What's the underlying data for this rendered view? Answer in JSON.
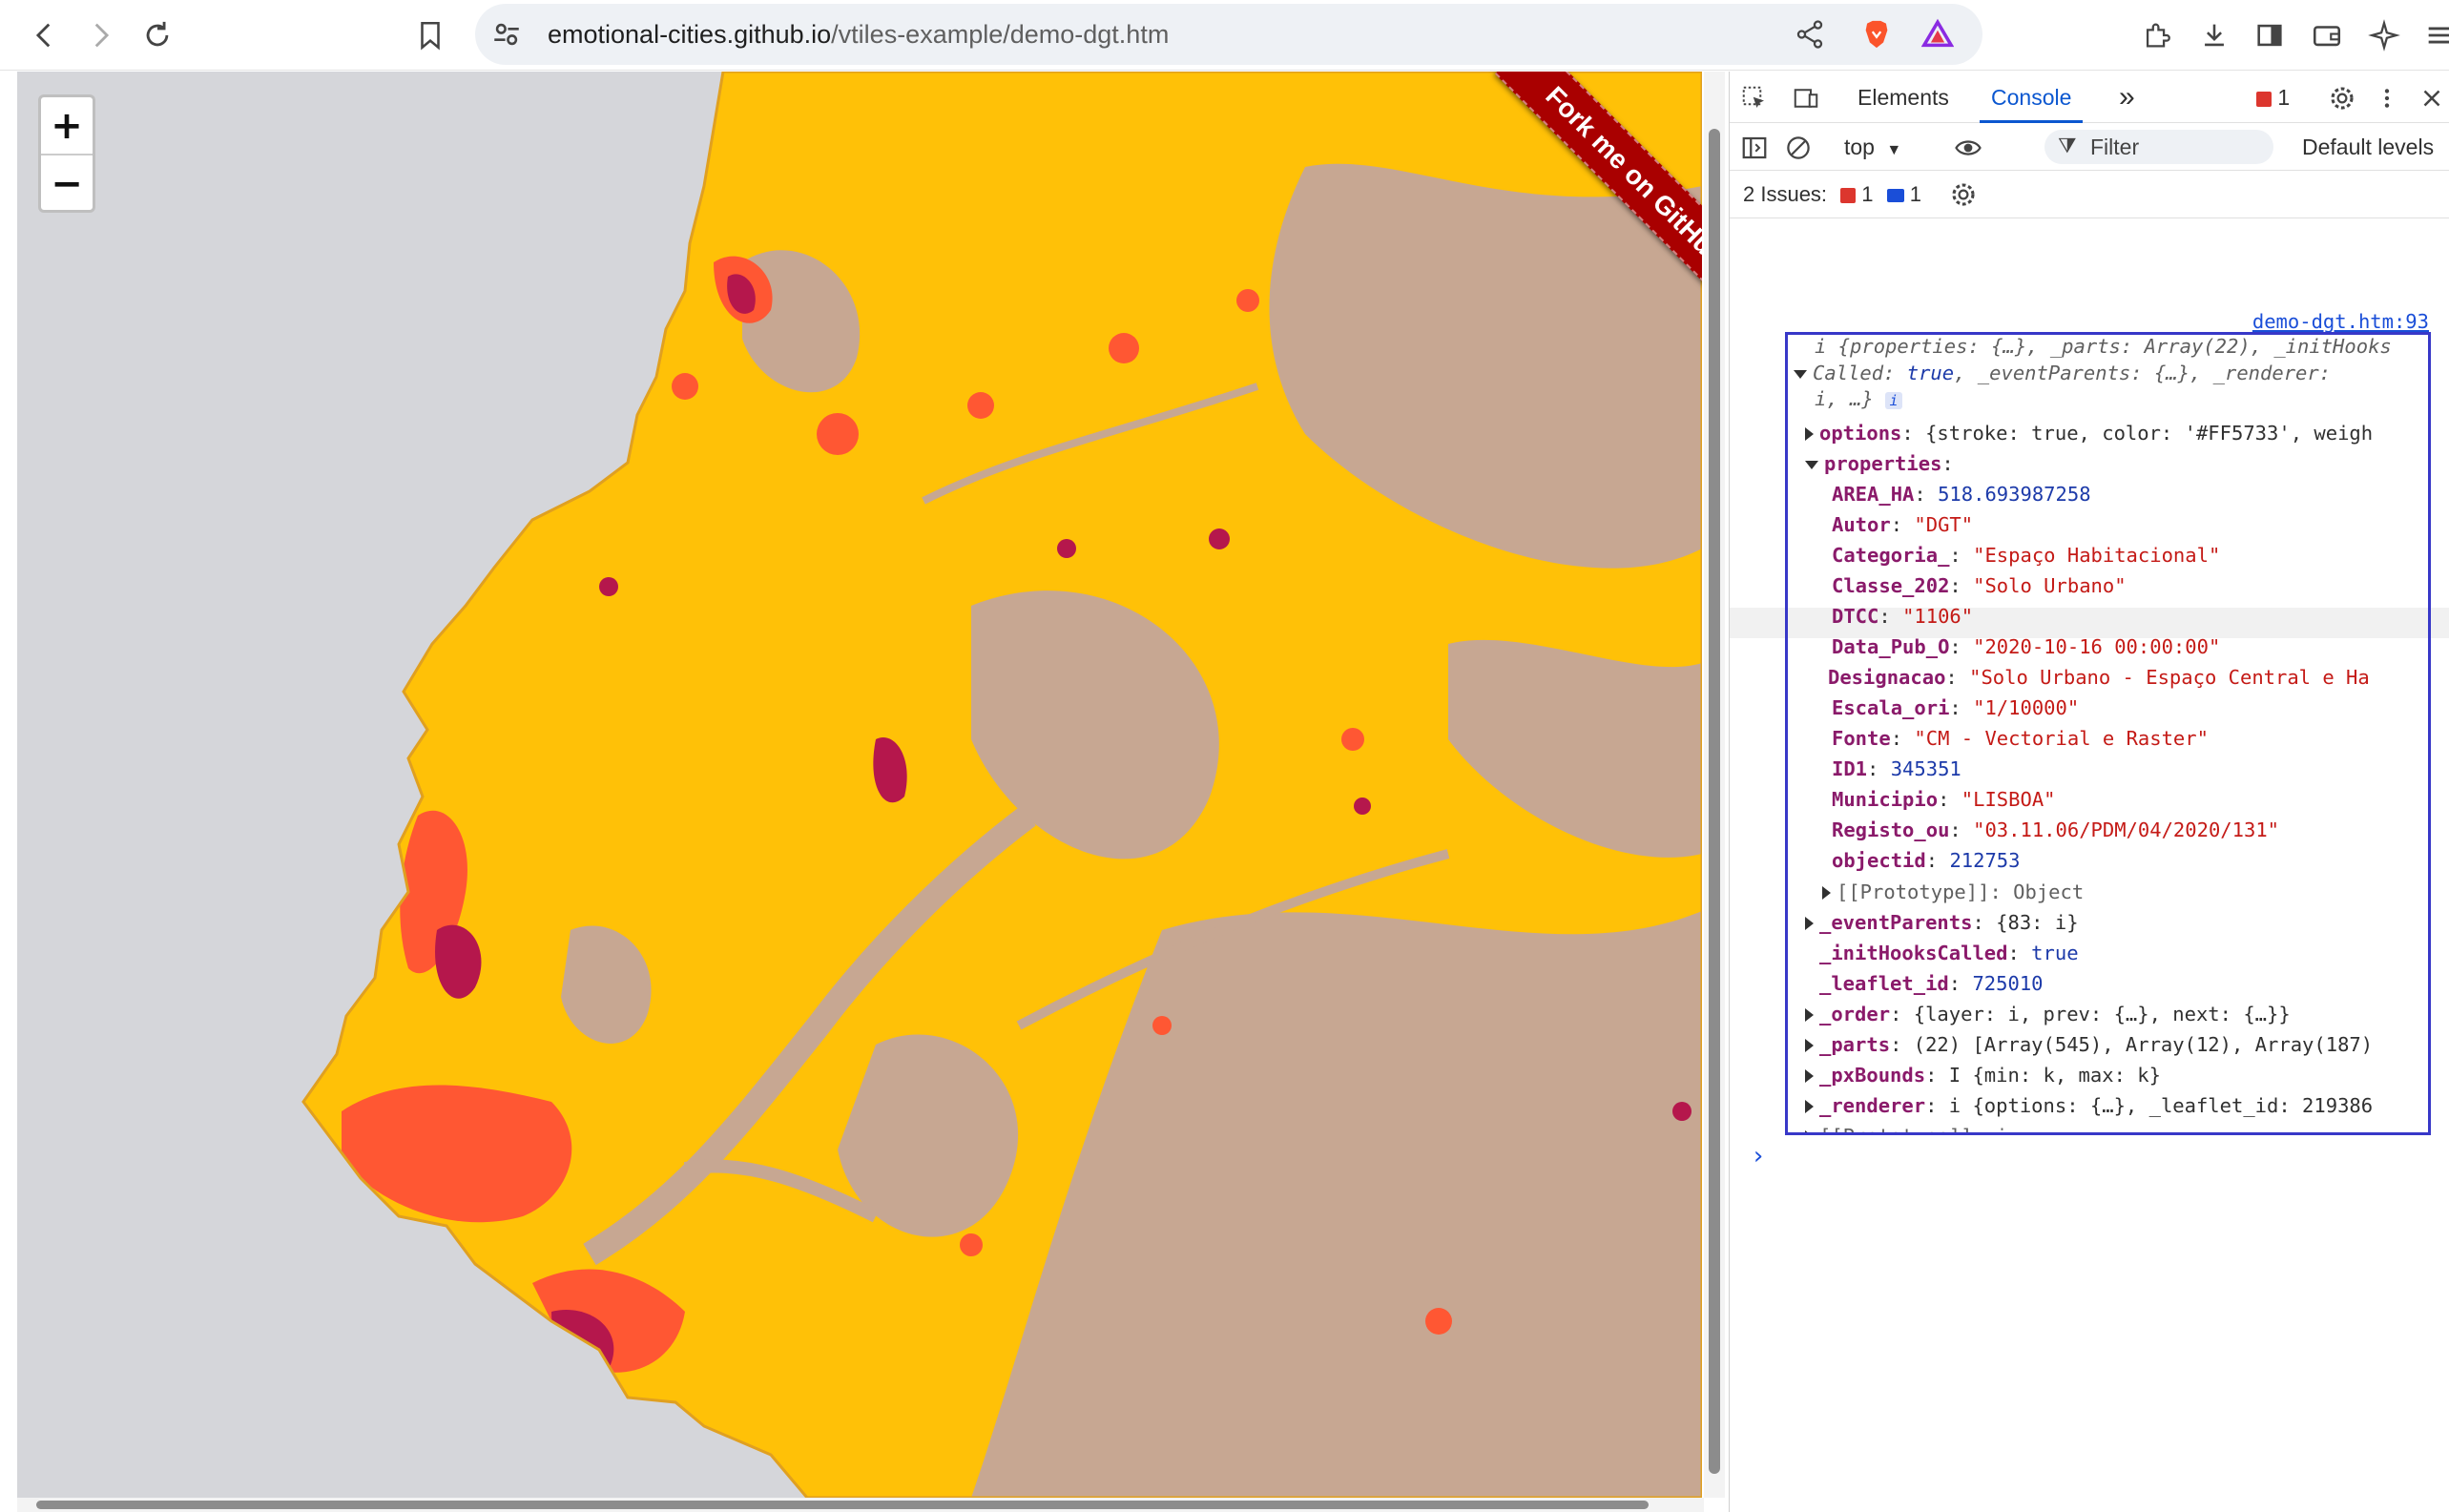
{
  "browser": {
    "url_domain": "emotional-cities.github.io",
    "url_path": "/vtiles-example/demo-dgt.htm"
  },
  "map": {
    "zoom_in_label": "+",
    "zoom_out_label": "−",
    "ribbon_text": "Fork me on GitHub",
    "colors": {
      "sea": "#d5d6da",
      "land": "#c7a792",
      "yellow_zones": "#ffc107",
      "urban": "#ff5733",
      "dense": "#b5174c"
    }
  },
  "devtools": {
    "tabs": {
      "elements": "Elements",
      "console": "Console",
      "more": "»",
      "error_count": "1"
    },
    "console_bar": {
      "context": "top",
      "filter_placeholder": "Filter",
      "levels": "Default levels"
    },
    "issues": {
      "label": "2 Issues:",
      "errors": "1",
      "messages": "1"
    },
    "source_link": "demo-dgt.htm:93",
    "object": {
      "summary_1": "i {properties: {…}, _parts: Array(22), _initHooks",
      "summary_2a": "Called: ",
      "summary_2b": "true",
      "summary_2c": ", _eventParents: {…}, _renderer:",
      "summary_3": "i, …}",
      "options_key": "options",
      "options_val": "{stroke: true, color: '#FF5733', weigh",
      "properties_key": "properties",
      "props": [
        {
          "key": "AREA_HA",
          "value": "518.693987258",
          "kind": "n"
        },
        {
          "key": "Autor",
          "value": "\"DGT\"",
          "kind": "s"
        },
        {
          "key": "Categoria_",
          "value": "\"Espaço Habitacional\"",
          "kind": "s"
        },
        {
          "key": "Classe_202",
          "value": "\"Solo Urbano\"",
          "kind": "s"
        },
        {
          "key": "DTCC",
          "value": "\"1106\"",
          "kind": "s"
        },
        {
          "key": "Data_Pub_O",
          "value": "\"2020-10-16 00:00:00\"",
          "kind": "s"
        },
        {
          "key": "Designacao",
          "value": "\"Solo Urbano - Espaço Central e Ha",
          "kind": "s"
        },
        {
          "key": "Escala_ori",
          "value": "\"1/10000\"",
          "kind": "s"
        },
        {
          "key": "Fonte",
          "value": "\"CM - Vectorial e Raster\"",
          "kind": "s"
        },
        {
          "key": "ID1",
          "value": "345351",
          "kind": "n"
        },
        {
          "key": "Municipio",
          "value": "\"LISBOA\"",
          "kind": "s"
        },
        {
          "key": "Registo_ou",
          "value": "\"03.11.06/PDM/04/2020/131\"",
          "kind": "s"
        },
        {
          "key": "objectid",
          "value": "212753",
          "kind": "n"
        }
      ],
      "prototype_object": "[[Prototype]]: Object",
      "event_parents_key": "_eventParents",
      "event_parents_val": "{83: i}",
      "init_hooks_key": "_initHooksCalled",
      "init_hooks_val": "true",
      "leaflet_id_key": "_leaflet_id",
      "leaflet_id_val": "725010",
      "order_key": "_order",
      "order_val": "{layer: i, prev: {…}, next: {…}}",
      "parts_key": "_parts",
      "parts_val": "(22) [Array(545), Array(12), Array(187)",
      "pxbounds_key": "_pxBounds",
      "pxbounds_val": "I {min: k, max: k}",
      "renderer_key": "_renderer",
      "renderer_val": "i {options: {…}, _leaflet_id: 219386",
      "prototype_i": "[[Prototype]]: i"
    },
    "prompt": "›"
  }
}
